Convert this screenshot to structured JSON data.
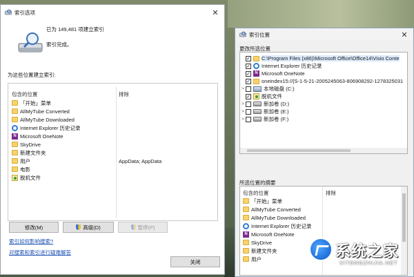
{
  "colors": {
    "link": "#1a4fb3",
    "folder": "#f7d36b",
    "selection": "#dceafd",
    "onenote": "#7b2a8c",
    "ie": "#2b7bd3"
  },
  "indexing_options": {
    "title": "索引选项",
    "status_count": "已为 149,481 项建立索引",
    "status_done": "索引完成。",
    "lead": "为这些位置建立索引:",
    "columns": {
      "included": "包含的位置",
      "excluded": "排除"
    },
    "rows": [
      {
        "icon": "folder-icon",
        "name": "「开始」菜单",
        "exclude": ""
      },
      {
        "icon": "folder-icon",
        "name": "AllMyTube Converted",
        "exclude": ""
      },
      {
        "icon": "folder-icon",
        "name": "AllMyTube Downloaded",
        "exclude": ""
      },
      {
        "icon": "internet-explorer-icon",
        "name": "Internet Explorer 历史记录",
        "exclude": ""
      },
      {
        "icon": "onenote-icon",
        "name": "Microsoft OneNote",
        "exclude": ""
      },
      {
        "icon": "folder-icon",
        "name": "SkyDrive",
        "exclude": ""
      },
      {
        "icon": "folder-icon",
        "name": "新建文件夹",
        "exclude": ""
      },
      {
        "icon": "folder-icon",
        "name": "用户",
        "exclude": "AppData; AppData"
      },
      {
        "icon": "folder-icon",
        "name": "电影",
        "exclude": ""
      },
      {
        "icon": "offline-files-icon",
        "name": "脱机文件",
        "exclude": ""
      }
    ],
    "buttons": {
      "modify": "修改(M)",
      "advanced": "高级(D)",
      "pause": "暂停(P)",
      "close": "关闭"
    },
    "links": {
      "how_indexing": "索引如何影响搜索?",
      "troubleshoot": "对搜索和索引进行疑难解答"
    }
  },
  "indexed_locations": {
    "title": "索引位置",
    "change_label": "更改所选位置",
    "summary_label": "所选位置的摘要",
    "tree": [
      {
        "expand": "",
        "checked": true,
        "icon": "folder-icon",
        "label": "C:\\Program Files (x86)\\Microsoft Office\\Office14\\Visio Conte",
        "selected": true
      },
      {
        "expand": "",
        "checked": true,
        "icon": "internet-explorer-icon",
        "label": "Internet Explorer 历史记录",
        "selected": false
      },
      {
        "expand": "",
        "checked": true,
        "icon": "onenote-icon",
        "label": "Microsoft OneNote",
        "selected": false
      },
      {
        "expand": "",
        "checked": true,
        "icon": "folder-icon",
        "label": "oneindex15://{S-1-5-21-2005245063-806908292-1278325031",
        "selected": false
      },
      {
        "expand": ">",
        "checked": false,
        "icon": "windows-drive-icon",
        "label": "本地磁盘 (C:)",
        "selected": false
      },
      {
        "expand": "",
        "checked": true,
        "icon": "offline-files-icon",
        "label": "脱机文件",
        "selected": false
      },
      {
        "expand": ">",
        "checked": false,
        "icon": "drive-icon",
        "label": "新加卷 (D:)",
        "selected": false
      },
      {
        "expand": ">",
        "checked": false,
        "icon": "drive-icon",
        "label": "新加卷 (E:)",
        "selected": false
      },
      {
        "expand": ">",
        "checked": false,
        "icon": "drive-icon",
        "label": "新加卷 (F:)",
        "selected": false
      }
    ],
    "summary_columns": {
      "included": "包含的位置",
      "excluded": "排除"
    },
    "summary_rows": [
      {
        "icon": "folder-icon",
        "name": "「开始」菜单"
      },
      {
        "icon": "folder-icon",
        "name": "AllMyTube Converted"
      },
      {
        "icon": "folder-icon",
        "name": "AllMyTube Downloaded"
      },
      {
        "icon": "internet-explorer-icon",
        "name": "Internet Explorer 历史记录"
      },
      {
        "icon": "onenote-icon",
        "name": "Microsoft OneNote"
      },
      {
        "icon": "folder-icon",
        "name": "SkyDrive"
      },
      {
        "icon": "folder-icon",
        "name": "新建文件夹"
      },
      {
        "icon": "folder-icon",
        "name": "用户"
      }
    ]
  },
  "watermark": {
    "cn": "系统之家",
    "en": "XITONGZHIJIA.NET"
  }
}
